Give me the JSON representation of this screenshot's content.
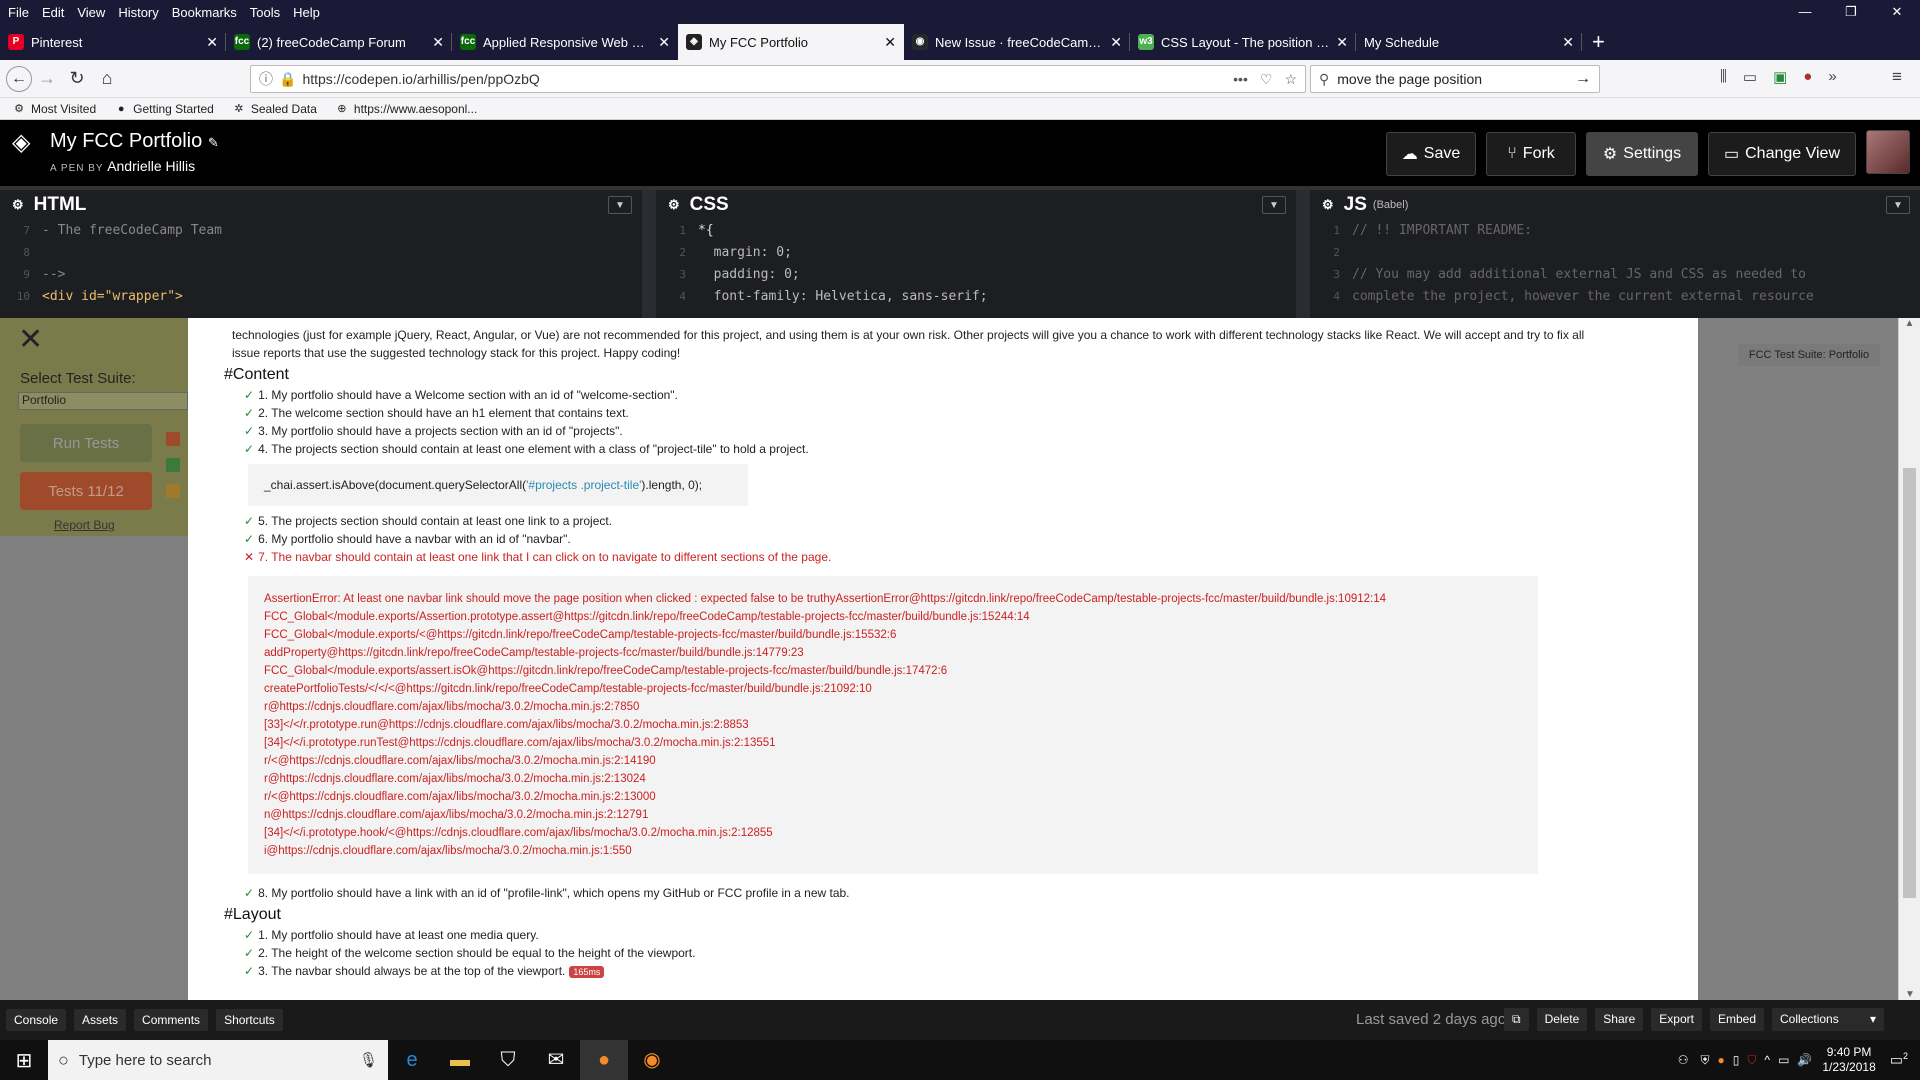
{
  "menu": [
    "File",
    "Edit",
    "View",
    "History",
    "Bookmarks",
    "Tools",
    "Help"
  ],
  "window_controls": [
    "—",
    "❐",
    "✕"
  ],
  "tabs": [
    {
      "label": "Pinterest",
      "icon": "pinterest-icon",
      "color": "#e60023",
      "glyph": "P"
    },
    {
      "label": "(2) freeCodeCamp Forum",
      "icon": "fcc-icon",
      "color": "#0a6a0a",
      "glyph": "fcc"
    },
    {
      "label": "Applied Responsive Web Design",
      "icon": "fcc-icon",
      "color": "#0a6a0a",
      "glyph": "fcc"
    },
    {
      "label": "My FCC Portfolio",
      "icon": "codepen-icon",
      "color": "#222",
      "glyph": "◈"
    },
    {
      "label": "New Issue · freeCodeCamp/testable",
      "icon": "github-icon",
      "color": "#24292e",
      "glyph": "◉"
    },
    {
      "label": "CSS Layout - The position Property",
      "icon": "w3-icon",
      "color": "#4caf50",
      "glyph": "w3"
    },
    {
      "label": "My Schedule",
      "icon": "",
      "color": "",
      "glyph": ""
    }
  ],
  "nav": {
    "url": "https://codepen.io/arhillis/pen/ppOzbQ",
    "search": "move the page position"
  },
  "bookmarks": [
    {
      "label": "Most Visited",
      "icon": "gear-icon",
      "glyph": "⚙"
    },
    {
      "label": "Getting Started",
      "icon": "firefox-icon",
      "glyph": "●"
    },
    {
      "label": "Sealed Data",
      "icon": "sealed-icon",
      "glyph": "✲"
    },
    {
      "label": "https://www.aesoponl...",
      "icon": "link-icon",
      "glyph": "⊕"
    }
  ],
  "codepen": {
    "title": "My FCC Portfolio",
    "by_label": "A PEN BY",
    "author": "Andrielle Hillis",
    "buttons": {
      "save": "Save",
      "fork": "Fork",
      "settings": "Settings",
      "change_view": "Change View"
    }
  },
  "editors": {
    "html": {
      "title": "HTML",
      "lines": [
        {
          "n": "7",
          "t": "- The freeCodeCamp Team"
        },
        {
          "n": "8",
          "t": ""
        },
        {
          "n": "9",
          "t": "-->"
        },
        {
          "n": "10",
          "t": "<div id=\"wrapper\">"
        }
      ]
    },
    "css": {
      "title": "CSS",
      "lines": [
        {
          "n": "1",
          "t": "*{"
        },
        {
          "n": "2",
          "t": "  margin: 0;"
        },
        {
          "n": "3",
          "t": "  padding: 0;"
        },
        {
          "n": "4",
          "t": "  font-family: Helvetica, sans-serif;"
        }
      ]
    },
    "js": {
      "title": "JS",
      "subtitle": "(Babel)",
      "lines": [
        {
          "n": "1",
          "t": "// !! IMPORTANT README:"
        },
        {
          "n": "2",
          "t": ""
        },
        {
          "n": "3",
          "t": "// You may add additional external JS and CSS as needed to"
        },
        {
          "n": "4",
          "t": "complete the project, however the current external resource"
        }
      ]
    }
  },
  "testpanel": {
    "label": "Select Test Suite:",
    "selected": "Portfolio",
    "run": "Run Tests",
    "tests": "Tests 11/12",
    "bug": "Report Bug",
    "suite_badge": "FCC Test Suite: Portfolio"
  },
  "intro": [
    "technologies (just for example jQuery, React, Angular, or Vue) are not recommended for this project, and using them is at your own risk. Other projects will give you a chance to work with different technology stacks like React. We will accept and try to fix all",
    "issue reports that use the suggested technology stack for this project. Happy coding!"
  ],
  "content_heading": "#Content",
  "content_tests_a": [
    "1. My portfolio should have a Welcome section with an id of \"welcome-section\".",
    "2. The welcome section should have an h1 element that contains text.",
    "3. My portfolio should have a projects section with an id of \"projects\".",
    "4. The projects section should contain at least one element with a class of \"project-tile\" to hold a project."
  ],
  "code_snippet": {
    "pre": "_chai.assert.isAbove(document.querySelectorAll(",
    "str": "'#projects .project-tile'",
    "post": ").length, 0);"
  },
  "content_tests_b": [
    "5. The projects section should contain at least one link to a project.",
    "6. My portfolio should have a navbar with an id of \"navbar\"."
  ],
  "failed_test": "7. The navbar should contain at least one link that I can click on to navigate to different sections of the page.",
  "error_lines": [
    "AssertionError: At least one navbar link should move the page position when clicked : expected false to be truthyAssertionError@https://gitcdn.link/repo/freeCodeCamp/testable-projects-fcc/master/build/bundle.js:10912:14",
    "FCC_Global</module.exports/Assertion.prototype.assert@https://gitcdn.link/repo/freeCodeCamp/testable-projects-fcc/master/build/bundle.js:15244:14",
    "FCC_Global</module.exports/<@https://gitcdn.link/repo/freeCodeCamp/testable-projects-fcc/master/build/bundle.js:15532:6",
    "addProperty@https://gitcdn.link/repo/freeCodeCamp/testable-projects-fcc/master/build/bundle.js:14779:23",
    "FCC_Global</module.exports/assert.isOk@https://gitcdn.link/repo/freeCodeCamp/testable-projects-fcc/master/build/bundle.js:17472:6",
    "createPortfolioTests/</</<@https://gitcdn.link/repo/freeCodeCamp/testable-projects-fcc/master/build/bundle.js:21092:10",
    "r@https://cdnjs.cloudflare.com/ajax/libs/mocha/3.0.2/mocha.min.js:2:7850",
    "[33]</</r.prototype.run@https://cdnjs.cloudflare.com/ajax/libs/mocha/3.0.2/mocha.min.js:2:8853",
    "[34]</</i.prototype.runTest@https://cdnjs.cloudflare.com/ajax/libs/mocha/3.0.2/mocha.min.js:2:13551",
    "r/<@https://cdnjs.cloudflare.com/ajax/libs/mocha/3.0.2/mocha.min.js:2:14190",
    "r@https://cdnjs.cloudflare.com/ajax/libs/mocha/3.0.2/mocha.min.js:2:13024",
    "r/<@https://cdnjs.cloudflare.com/ajax/libs/mocha/3.0.2/mocha.min.js:2:13000",
    "n@https://cdnjs.cloudflare.com/ajax/libs/mocha/3.0.2/mocha.min.js:2:12791",
    "[34]</</i.prototype.hook/<@https://cdnjs.cloudflare.com/ajax/libs/mocha/3.0.2/mocha.min.js:2:12855",
    "i@https://cdnjs.cloudflare.com/ajax/libs/mocha/3.0.2/mocha.min.js:1:550"
  ],
  "content_tests_c": [
    "8. My portfolio should have a link with an id of \"profile-link\", which opens my GitHub or FCC profile in a new tab."
  ],
  "layout_heading": "#Layout",
  "layout_tests": [
    "1. My portfolio should have at least one media query.",
    "2. The height of the welcome section should be equal to the height of the viewport.",
    "3. The navbar should always be at the top of the viewport."
  ],
  "timing_badge": "165ms",
  "footer": {
    "left": [
      "Console",
      "Assets",
      "Comments",
      "Shortcuts"
    ],
    "last_saved": "Last saved 2 days ago",
    "right": [
      "Delete",
      "Share",
      "Export",
      "Embed"
    ],
    "collections": "Collections"
  },
  "taskbar": {
    "search": "Type here to search",
    "time": "9:40 PM",
    "date": "1/23/2018",
    "notif": "2"
  },
  "colors": {
    "pass": "#2a8a3a",
    "fail": "#cc2222",
    "codepen_bg": "#000000",
    "tab_bar": "#1a1a36"
  }
}
